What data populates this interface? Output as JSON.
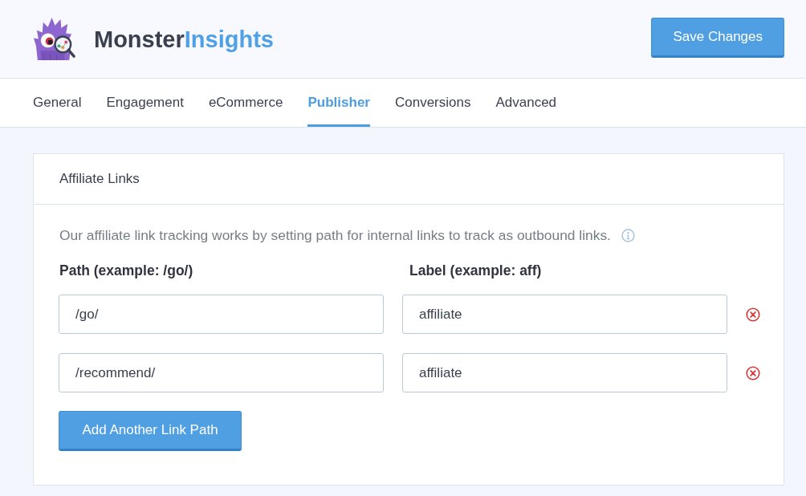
{
  "header": {
    "logo": {
      "text": "Monster",
      "accent_text": "Insights"
    },
    "save_button": "Save Changes"
  },
  "tabs": [
    {
      "label": "General",
      "selected": false
    },
    {
      "label": "Engagement",
      "selected": false
    },
    {
      "label": "eCommerce",
      "selected": false
    },
    {
      "label": "Publisher",
      "selected": true
    },
    {
      "label": "Conversions",
      "selected": false
    },
    {
      "label": "Advanced",
      "selected": false
    }
  ],
  "panel": {
    "title": "Affiliate Links",
    "description": "Our affiliate link tracking works by setting path for internal links to track as outbound links.",
    "columns": [
      "Path (example: /go/)",
      "Label (example: aff)"
    ],
    "rows": [
      {
        "path": "/go/",
        "label": "affiliate"
      },
      {
        "path": "/recommend/",
        "label": "affiliate"
      }
    ],
    "add_button": "Add Another Link Path"
  }
}
